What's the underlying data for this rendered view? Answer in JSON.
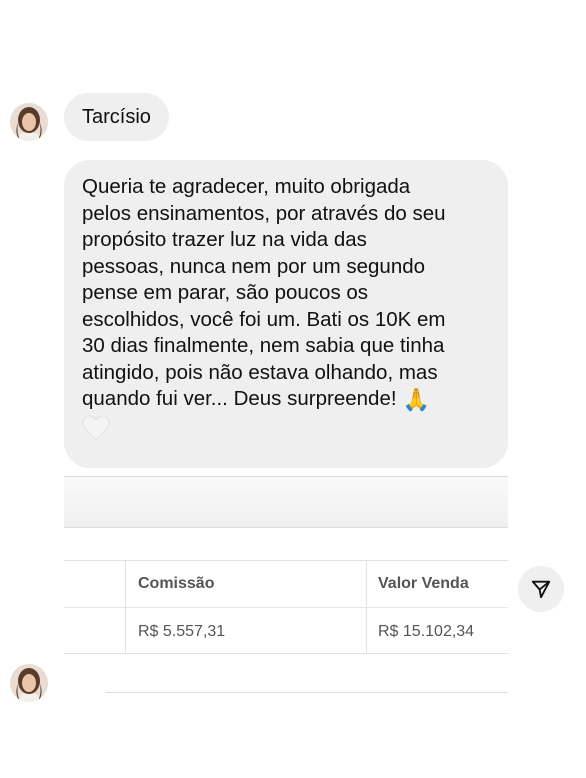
{
  "sender": {
    "name": "Tarcísio",
    "avatar_icon": "profile-photo-avatar"
  },
  "message": {
    "lines": [
      "Queria te agradecer, muito obrigada",
      "pelos ensinamentos, por através do seu",
      "propósito trazer luz na vida das",
      "pessoas, nunca nem por um segundo",
      "pense em parar, são poucos os",
      "escolhidos, você foi um. Bati os 10K em",
      "30 dias finalmente, nem sabia que tinha",
      "atingido, pois não estava olhando, mas",
      "quando fui ver... Deus surpreende!"
    ],
    "emoji_pray": "🙏",
    "emoji_heart": "white-heart-icon"
  },
  "attachment": {
    "table": {
      "headers": [
        "",
        "Comissão",
        "Valor Venda"
      ],
      "rows": [
        [
          "",
          "R$ 5.557,31",
          "R$ 15.102,34"
        ]
      ]
    }
  },
  "actions": {
    "share_icon": "send-icon"
  },
  "colors": {
    "bubble": "#efefef",
    "text": "#111111",
    "table_text": "#555555"
  }
}
